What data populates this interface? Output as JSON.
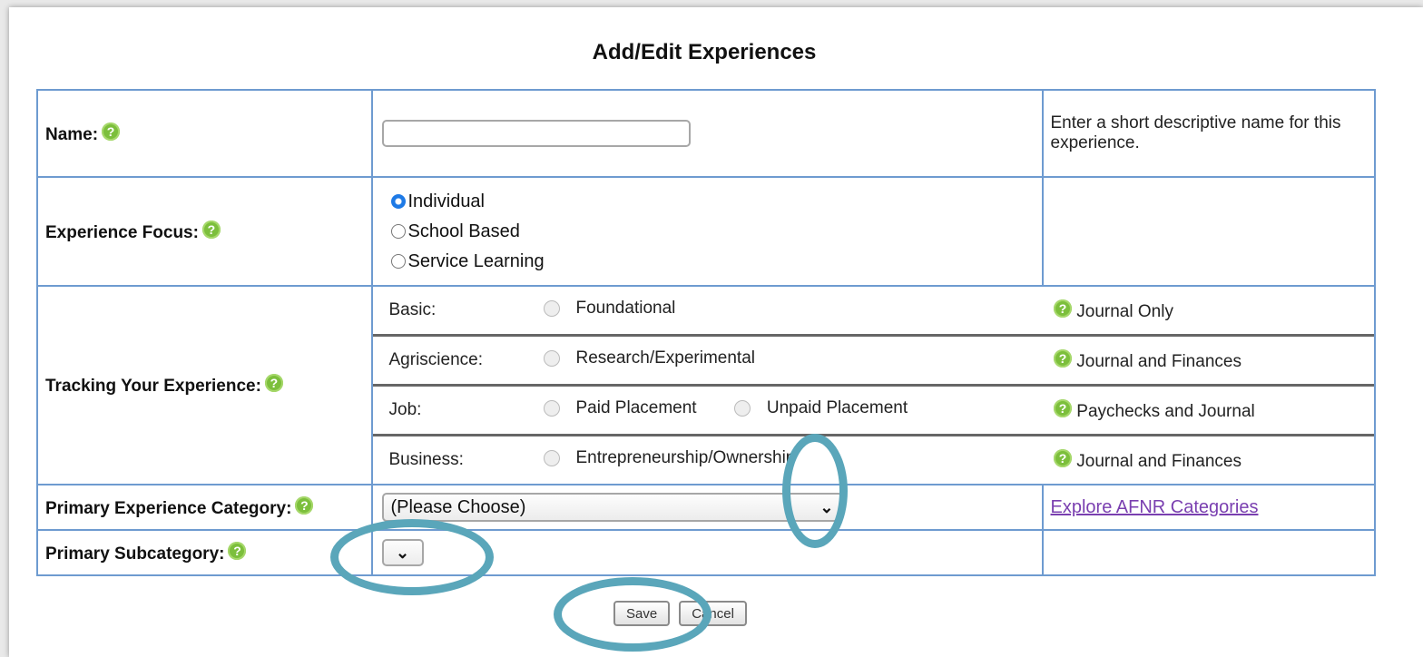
{
  "title": "Add/Edit Experiences",
  "name_row": {
    "label": "Name:",
    "value": "",
    "placeholder": "",
    "hint": "Enter a short descriptive name for this experience."
  },
  "focus_row": {
    "label": "Experience Focus:",
    "options": [
      {
        "label": "Individual",
        "checked": true
      },
      {
        "label": "School Based",
        "checked": false
      },
      {
        "label": "Service Learning",
        "checked": false
      }
    ]
  },
  "tracking_row": {
    "label": "Tracking Your Experience:",
    "rows": [
      {
        "label": "Basic:",
        "options": [
          "Foundational"
        ],
        "type": "Journal Only"
      },
      {
        "label": "Agriscience:",
        "options": [
          "Research/Experimental"
        ],
        "type": "Journal and Finances"
      },
      {
        "label": "Job:",
        "options": [
          "Paid Placement",
          "Unpaid Placement"
        ],
        "type": "Paychecks and Journal"
      },
      {
        "label": "Business:",
        "options": [
          "Entrepreneurship/Ownership"
        ],
        "type": "Journal and Finances"
      }
    ]
  },
  "category_row": {
    "label": "Primary Experience Category:",
    "selected": "(Please Choose)",
    "link": "Explore AFNR Categories"
  },
  "subcategory_row": {
    "label": "Primary Subcategory:"
  },
  "buttons": {
    "save": "Save",
    "cancel": "Cancel"
  },
  "help_glyph": "?",
  "colors": {
    "border": "#6e9bd0",
    "help_icon": "#7cbf3c",
    "link": "#7a3fb0",
    "annotation": "#5aa6ba"
  }
}
